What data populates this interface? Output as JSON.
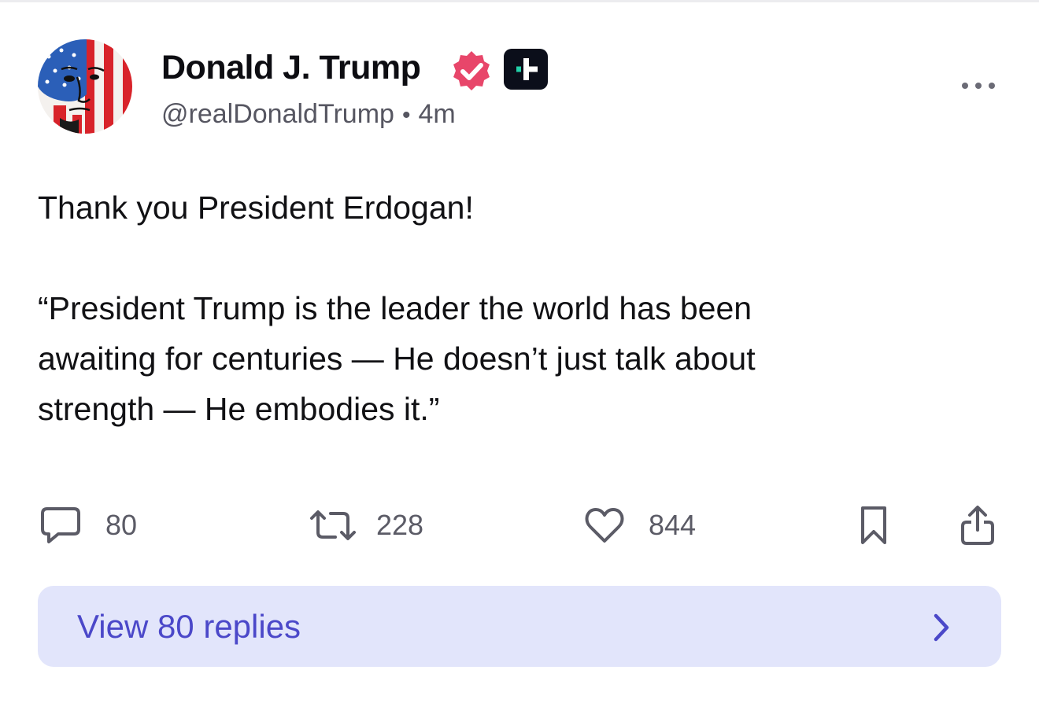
{
  "post": {
    "author": {
      "name": "Donald J. Trump",
      "handle": "@realDonaldTrump",
      "time": "4m",
      "separator": "•"
    },
    "body": {
      "line1": "Thank you President Erdogan!",
      "quote_lines": [
        "“President Trump is the leader the world has been",
        "awaiting for centuries — He doesn’t just talk about",
        "strength — He embodies it.”"
      ]
    },
    "actions": {
      "replies_count": "80",
      "reposts_count": "228",
      "likes_count": "844"
    },
    "view_replies_label": "View 80 replies"
  },
  "icons": {
    "verified": "verified-badge-icon",
    "plus_badge": "plus-badge-icon",
    "more": "more-options-icon",
    "reply": "comment-bubble-icon",
    "repost": "repost-arrows-icon",
    "like": "heart-icon",
    "bookmark": "bookmark-icon",
    "share": "share-icon",
    "chevron": "chevron-right-icon"
  },
  "colors": {
    "verified_badge": "#e8466a",
    "plus_badge_bg": "#0b0e1a",
    "plus_badge_accent": "#22d1a9",
    "replies_bar_bg": "#e2e5fb",
    "replies_bar_text": "#4b48c9",
    "icon_gray": "#5b5b66"
  }
}
